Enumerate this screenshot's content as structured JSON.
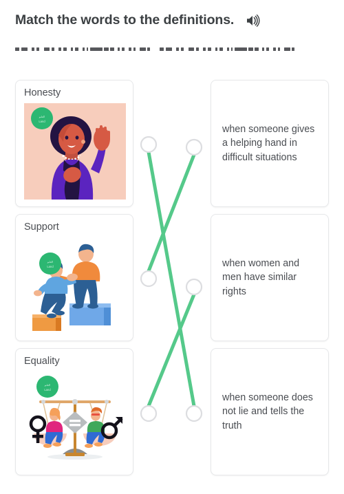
{
  "header": {
    "title": "Match the words to the definitions.",
    "audio_icon": "speaker-icon"
  },
  "subtitle_redacted": {
    "note": "blurred-unreadable-text-line",
    "visible_text": ""
  },
  "colors": {
    "connector_line": "#55c98a",
    "connector_dot_fill": "#ffffff",
    "connector_dot_border": "#dcdde0",
    "card_border": "#e6e7e9",
    "text": "#4a4d52",
    "title_text": "#3c4043",
    "badge_green": "#2cb772"
  },
  "words": [
    {
      "label": "Honesty",
      "image": "woman-raising-hand-oath-illustration",
      "badge": "green-round-badge"
    },
    {
      "label": "Support",
      "image": "person-helping-another-climb-blocks-illustration",
      "badge": "green-round-badge"
    },
    {
      "label": "Equality",
      "image": "balance-scale-woman-man-gender-symbols-illustration",
      "badge": "green-round-badge"
    }
  ],
  "definitions": [
    {
      "text": "when someone gives a helping hand in difficult situations"
    },
    {
      "text": "when women and men have similar rights"
    },
    {
      "text": "when someone does not lie and tells the truth"
    }
  ],
  "connections": [
    {
      "from": "left-dot-1",
      "to": "right-dot-3"
    },
    {
      "from": "left-dot-2",
      "to": "right-dot-1"
    },
    {
      "from": "left-dot-3",
      "to": "right-dot-2"
    }
  ],
  "dots": {
    "left": [
      {
        "name": "left-dot-1"
      },
      {
        "name": "left-dot-2"
      },
      {
        "name": "left-dot-3"
      }
    ],
    "right": [
      {
        "name": "right-dot-1"
      },
      {
        "name": "right-dot-2"
      },
      {
        "name": "right-dot-3"
      }
    ]
  }
}
